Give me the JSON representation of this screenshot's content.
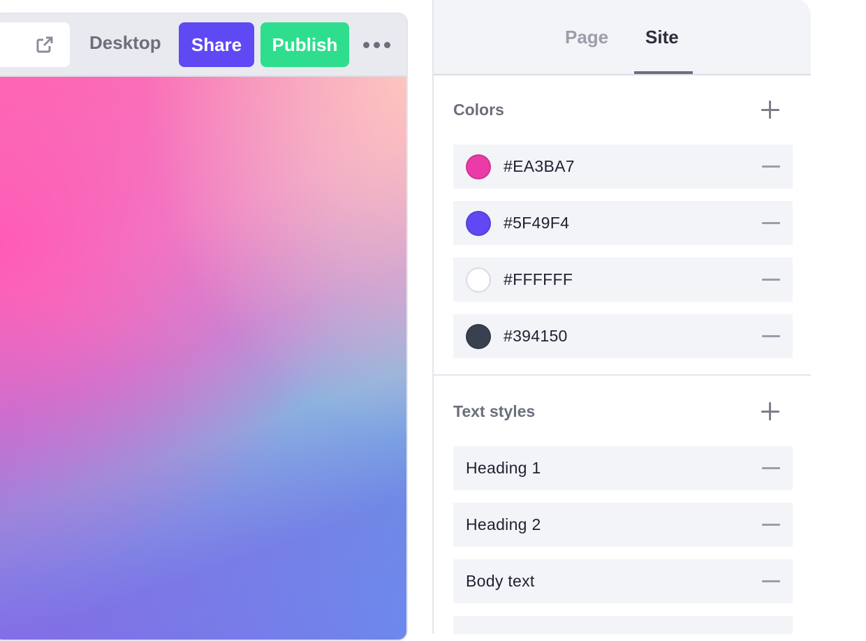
{
  "toolbar": {
    "device": "Desktop",
    "share_label": "Share",
    "publish_label": "Publish",
    "share_color": "#5F49F4",
    "publish_color": "#2EDE8E",
    "external_link_icon": "external-link-icon",
    "more_icon": "more-horizontal-icon"
  },
  "panel": {
    "tabs": [
      {
        "label": "Page",
        "active": false
      },
      {
        "label": "Site",
        "active": true
      }
    ],
    "colors": {
      "title": "Colors",
      "items": [
        {
          "hex": "#EA3BA7"
        },
        {
          "hex": "#5F49F4"
        },
        {
          "hex": "#FFFFFF"
        },
        {
          "hex": "#394150"
        }
      ]
    },
    "text_styles": {
      "title": "Text styles",
      "items": [
        {
          "label": "Heading 1"
        },
        {
          "label": "Heading 2"
        },
        {
          "label": "Body text"
        }
      ]
    }
  }
}
